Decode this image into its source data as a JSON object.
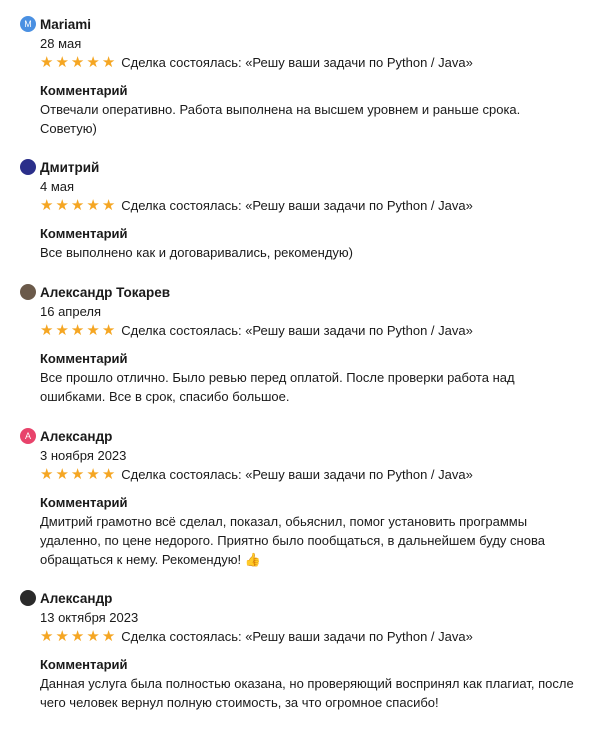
{
  "colors": {
    "star": "#f5a623",
    "text": "#1a1a1a"
  },
  "reviews": [
    {
      "name": "Mariami",
      "avatar_letter": "M",
      "avatar_color": "#4a90e2",
      "date": "28 мая",
      "rating": 5,
      "deal": "Сделка состоялась: «Решу ваши задачи по Python / Java»",
      "comment_title": "Комментарий",
      "comment": "Отвечали оперативно. Работа выполнена на высшем уровнем и раньше срока. Советую)"
    },
    {
      "name": "Дмитрий",
      "avatar_letter": "",
      "avatar_color": "#2b2f8a",
      "date": "4 мая",
      "rating": 5,
      "deal": "Сделка состоялась: «Решу ваши задачи по Python / Java»",
      "comment_title": "Комментарий",
      "comment": "Все выполнено как и договаривались, рекомендую)"
    },
    {
      "name": "Александр Токарев",
      "avatar_letter": "",
      "avatar_color": "#6b5a4a",
      "date": "16 апреля",
      "rating": 5,
      "deal": "Сделка состоялась: «Решу ваши задачи по Python / Java»",
      "comment_title": "Комментарий",
      "comment": "Все прошло отлично. Было ревью перед оплатой. После проверки работа над ошибками. Все в срок, спасибо большое."
    },
    {
      "name": "Александр",
      "avatar_letter": "А",
      "avatar_color": "#e8436b",
      "date": "3 ноября 2023",
      "rating": 5,
      "deal": "Сделка состоялась: «Решу ваши задачи по Python / Java»",
      "comment_title": "Комментарий",
      "comment": "Дмитрий грамотно всё сделал, показал, обьяснил, помог установить программы удаленно, по цене недорого. Приятно было пообщаться, в дальнейшем буду снова обращаться к нему. Рекомендую! 👍"
    },
    {
      "name": "Александр",
      "avatar_letter": "",
      "avatar_color": "#2a2a2a",
      "date": "13 октября 2023",
      "rating": 5,
      "deal": "Сделка состоялась: «Решу ваши задачи по Python / Java»",
      "comment_title": "Комментарий",
      "comment": "Данная услуга была полностью оказана, но проверяющий воспринял как плагиат, после чего человек вернул полную стоимость, за что огромное спасибо!"
    }
  ]
}
